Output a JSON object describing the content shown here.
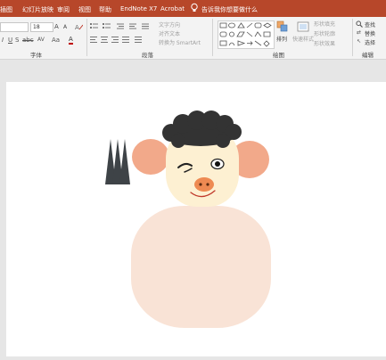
{
  "tabs": {
    "items": [
      "插图",
      "幻灯片放映",
      "审阅",
      "视图",
      "帮助",
      "EndNote X7",
      "Acrobat"
    ],
    "tell_me": "告诉我你想要做什么"
  },
  "ribbon": {
    "font": {
      "size_value": "18",
      "grow_label": "A",
      "shrink_label": "A",
      "case_label": "Aa",
      "spacing_label": "AV",
      "color_label": "A",
      "group_label": "字体"
    },
    "paragraph": {
      "text_direction": "文字方向",
      "align_text": "对齐文本",
      "smartart": "转换为 SmartArt",
      "group_label": "段落"
    },
    "drawing": {
      "arrange": "排列",
      "quick_styles": "快速样式",
      "shape_fill": "形状填充",
      "shape_outline": "形状轮廓",
      "shape_effects": "形状效果",
      "group_label": "绘图"
    },
    "editing": {
      "find": "查找",
      "replace": "替换",
      "select": "选择",
      "group_label": "编辑"
    }
  },
  "colors": {
    "tab_bar": "#b7472a",
    "hair": "#333333",
    "ears": "#f2a98a",
    "face": "#fdf0d2",
    "nose": "#ee8a52",
    "body": "#f9e3d6",
    "triangles": "#3e4347"
  }
}
